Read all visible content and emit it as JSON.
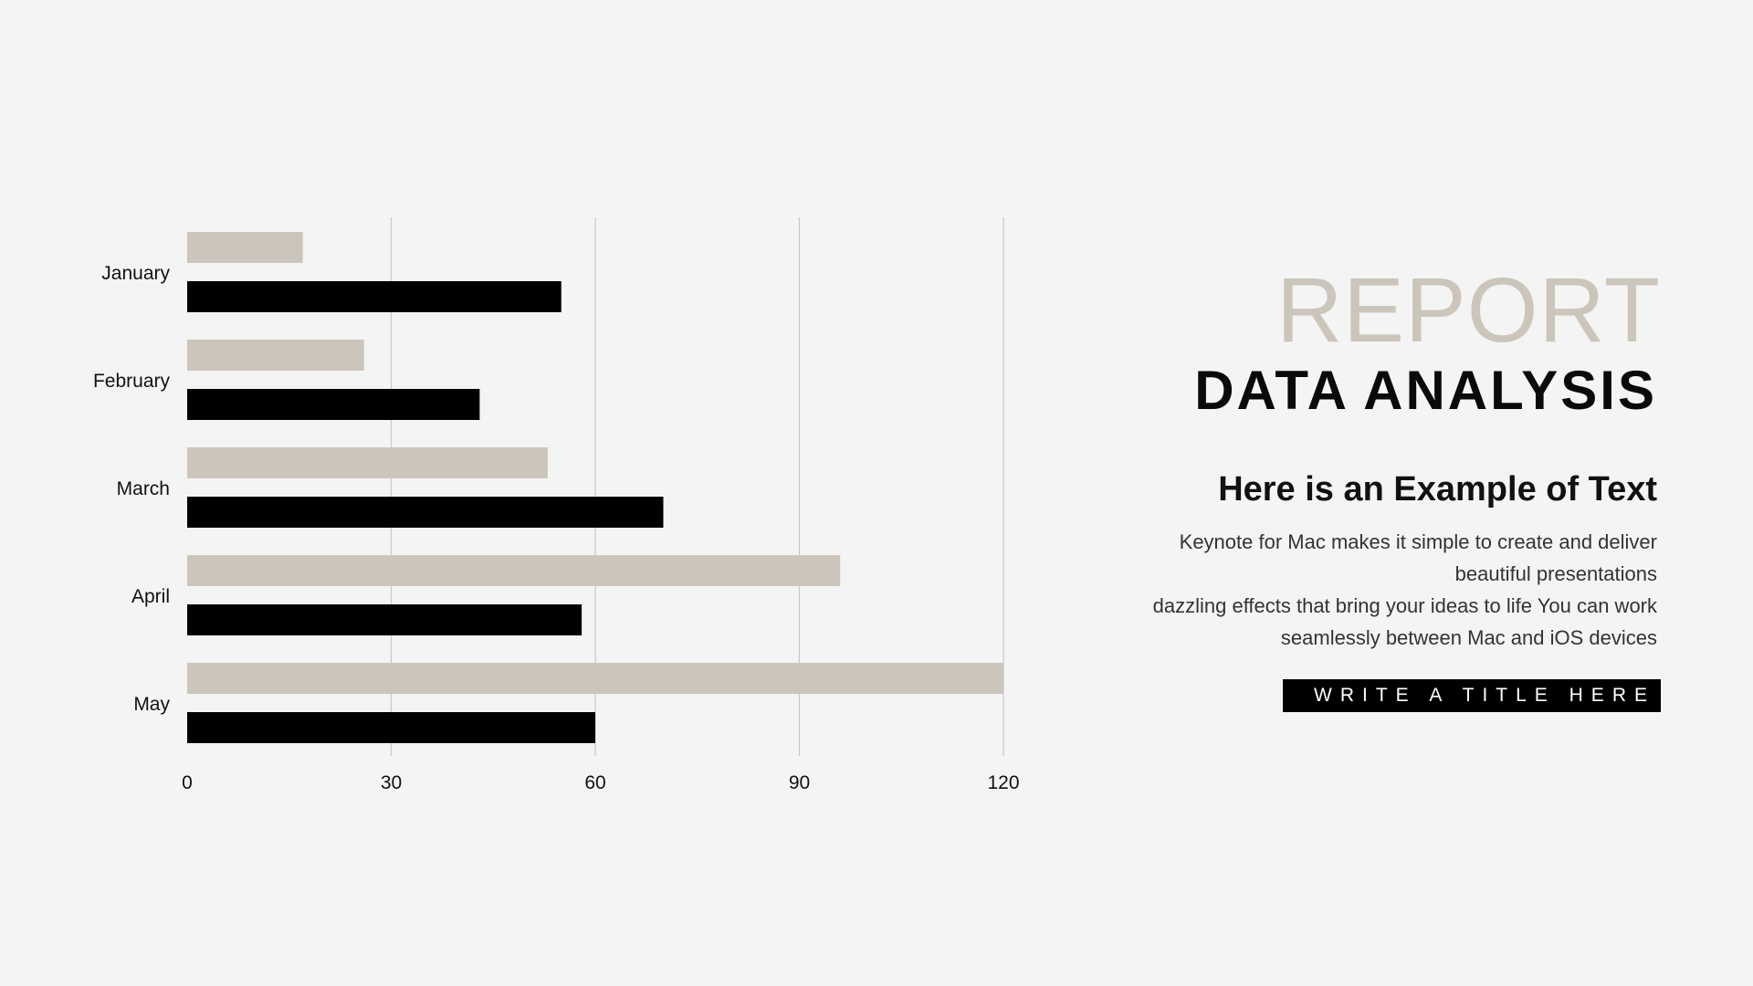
{
  "colors": {
    "background": "#f4f4f4",
    "series_light": "#cbc5bb",
    "series_dark": "#000000",
    "accent_title": "#cbc5bb",
    "gridline": "#c8c8c8"
  },
  "chart_data": {
    "type": "bar",
    "orientation": "horizontal",
    "categories": [
      "January",
      "February",
      "March",
      "April",
      "May"
    ],
    "series": [
      {
        "values": [
          17,
          26,
          53,
          96,
          120
        ],
        "color": "#cbc5bb"
      },
      {
        "values": [
          55,
          43,
          70,
          58,
          60
        ],
        "color": "#000000"
      }
    ],
    "x_ticks": [
      "0",
      "30",
      "60",
      "90",
      "120"
    ],
    "xlim": [
      0,
      120
    ],
    "grid": true,
    "legend": "none"
  },
  "panel": {
    "title": "REPORT",
    "subtitle": "DATA ANALYSIS",
    "heading": "Here is an Example of Text",
    "body_lines": [
      "Keynote for Mac makes it simple to create and deliver",
      "beautiful presentations",
      "dazzling effects that bring your ideas to life You can work",
      "seamlessly between Mac and iOS devices"
    ],
    "button_label": "WRITE A TITLE HERE"
  }
}
